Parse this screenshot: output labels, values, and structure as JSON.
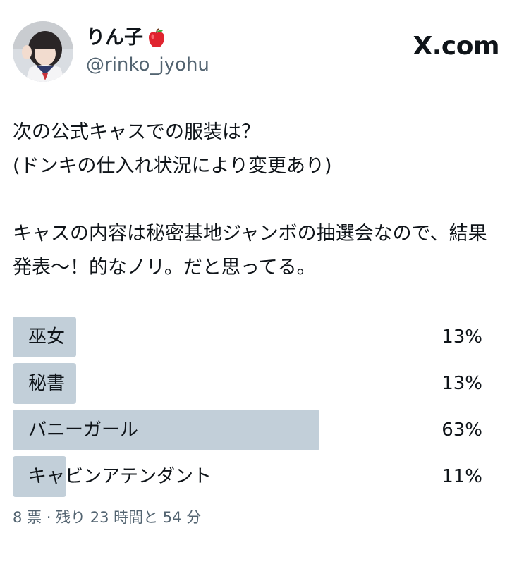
{
  "author": {
    "display_name": "りん子",
    "emoji_icon": "red-apple-icon",
    "handle": "@rinko_jyohu"
  },
  "brand": {
    "site": "X.com"
  },
  "tweet": {
    "text": "次の公式キャスでの服装は？\n(ドンキの仕入れ状況により変更あり)\n\nキャスの内容は秘密基地ジャンボの抽選会なので、結果発表〜！的なノリ。だと思ってる。"
  },
  "poll": {
    "bar_color": "#c2cfd9",
    "options": [
      {
        "label": "巫女",
        "percent_text": "13%",
        "percent": 13
      },
      {
        "label": "秘書",
        "percent_text": "13%",
        "percent": 13
      },
      {
        "label": "バニーガール",
        "percent_text": "63%",
        "percent": 63
      },
      {
        "label": "キャビンアテンダント",
        "percent_text": "11%",
        "percent": 11
      }
    ],
    "meta": "8 票 · 残り 23 時間と 54 分"
  }
}
